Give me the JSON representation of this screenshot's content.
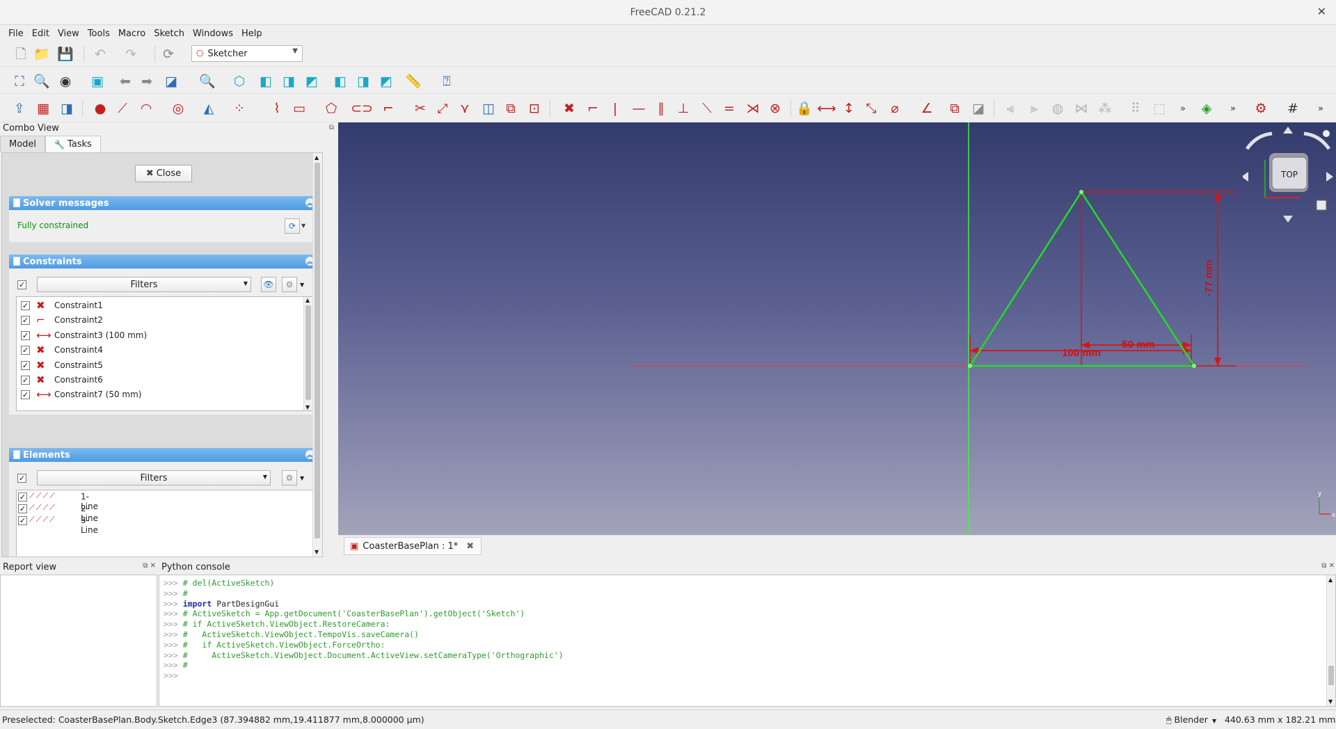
{
  "window": {
    "title": "FreeCAD 0.21.2"
  },
  "menu": [
    "File",
    "Edit",
    "View",
    "Tools",
    "Macro",
    "Sketch",
    "Windows",
    "Help"
  ],
  "workbench": {
    "selected": "Sketcher"
  },
  "combo": {
    "title": "Combo View",
    "tabs": [
      {
        "label": "Model"
      },
      {
        "label": "Tasks"
      }
    ],
    "close_label": "Close",
    "solver": {
      "title": "Solver messages",
      "status": "Fully constrained",
      "status_color": "#0b8f0b"
    },
    "constraints": {
      "title": "Constraints",
      "filter_label": "Filters",
      "items": [
        {
          "label": "Constraint1",
          "icon": "coincident-icon"
        },
        {
          "label": "Constraint2",
          "icon": "point-on-object-icon"
        },
        {
          "label": "Constraint3 (100 mm)",
          "icon": "horizontal-distance-icon"
        },
        {
          "label": "Constraint4",
          "icon": "coincident-icon"
        },
        {
          "label": "Constraint5",
          "icon": "coincident-icon"
        },
        {
          "label": "Constraint6",
          "icon": "coincident-icon"
        },
        {
          "label": "Constraint7 (50 mm)",
          "icon": "horizontal-distance-icon"
        }
      ]
    },
    "elements": {
      "title": "Elements",
      "filter_label": "Filters",
      "items": [
        {
          "label": "1-Line"
        },
        {
          "label": "2-Line"
        },
        {
          "label": "3-Line"
        }
      ]
    }
  },
  "viewport": {
    "dimension_labels": {
      "base": "100 mm",
      "half": "50 mm",
      "height": "-77 mm"
    },
    "navcube_face": "TOP",
    "colors": {
      "geometry": "#22dd22",
      "constraint": "#dd1111",
      "axis_v": "#44ee44",
      "axis_h": "#ff3333"
    }
  },
  "doc_tab": {
    "label": "CoasterBasePlan : 1*"
  },
  "report": {
    "title": "Report view"
  },
  "console": {
    "title": "Python console",
    "lines": [
      {
        "prompt": ">>>",
        "text": "# del(ActiveSketch)",
        "kind": "comment"
      },
      {
        "prompt": ">>>",
        "text": "#",
        "kind": "comment"
      },
      {
        "prompt": ">>>",
        "kw": "import",
        "text": " PartDesignGui",
        "kind": "import"
      },
      {
        "prompt": ">>>",
        "text": "# ActiveSketch = App.getDocument('CoasterBasePlan').getObject('Sketch')",
        "kind": "comment"
      },
      {
        "prompt": ">>>",
        "text": "# if ActiveSketch.ViewObject.RestoreCamera:",
        "kind": "comment"
      },
      {
        "prompt": ">>>",
        "text": "#   ActiveSketch.ViewObject.TempoVis.saveCamera()",
        "kind": "comment"
      },
      {
        "prompt": ">>>",
        "text": "#   if ActiveSketch.ViewObject.ForceOrtho:",
        "kind": "comment"
      },
      {
        "prompt": ">>>",
        "text": "#     ActiveSketch.ViewObject.Document.ActiveView.setCameraType('Orthographic')",
        "kind": "comment"
      },
      {
        "prompt": ">>>",
        "text": "#",
        "kind": "comment"
      },
      {
        "prompt": ">>>",
        "text": "",
        "kind": "blank"
      }
    ]
  },
  "status": {
    "preselected": "Preselected: CoasterBasePlan.Body.Sketch.Edge3 (87.394882 mm,19.411877 mm,8.000000 µm)",
    "nav_style": "Blender",
    "dimensions": "440.63 mm x 182.21 mm"
  }
}
